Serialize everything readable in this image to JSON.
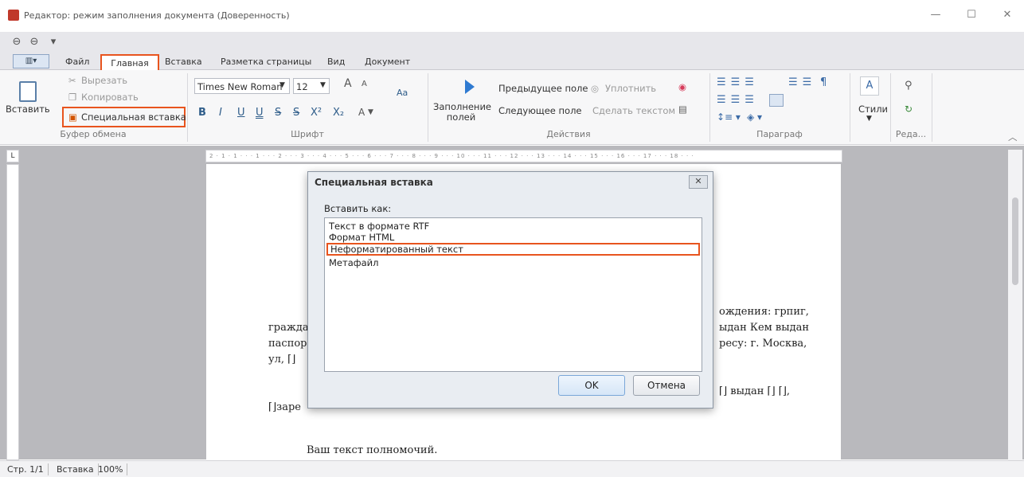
{
  "window": {
    "title": "Редактор: режим заполнения документа (Доверенность)",
    "minimize": "—",
    "maximize": "☐",
    "close": "✕"
  },
  "ribbon_tabs": [
    "Файл",
    "Главная",
    "Вставка",
    "Разметка страницы",
    "Вид",
    "Документ"
  ],
  "view_toggle": "▥▾",
  "clipboard": {
    "paste": "Вставить",
    "cut": "Вырезать",
    "copy": "Копировать",
    "paste_special": "Специальная вставка",
    "group_label": "Буфер обмена"
  },
  "font": {
    "family": "Times New Roman",
    "size": "12",
    "grow": "A",
    "shrink": "A",
    "case": "Aa",
    "bold": "B",
    "italic": "I",
    "underline": "U",
    "double_underline": "U",
    "strike": "S",
    "double_strike": "S",
    "superscript": "X²",
    "subscript": "X₂",
    "color": "A",
    "group_label": "Шрифт"
  },
  "actions": {
    "fill_fields": "Заполнение полей",
    "prev_field": "Предыдущее поле",
    "next_field": "Следующее поле",
    "compact": "Уплотнить",
    "make_text": "Сделать текстом",
    "group_label": "Действия"
  },
  "paragraph": {
    "group_label": "Параграф",
    "pilcrow": "¶"
  },
  "styles": {
    "label": "Стили",
    "edit_label": "Реда..."
  },
  "ruler": {
    "corner": "L",
    "marks": "2 · 1 · 1 · · · 1 · · · 2 · · · 3 · · · 4 · · · 5 · · · 6 · · · 7 · · · 8 · · · 9 · · · 10 · · · 11 · · · 12 · · · 13 · · · 14 · · · 15 · · · 16 · · · 17 · · · 18 · · ·"
  },
  "document": {
    "line1_right": "ождения: грпиг,",
    "line2_left": "граждан",
    "line2_right": "ыдан Кем выдан",
    "line3_left": "паспорт",
    "line3_right": "ресу: г. Москва,",
    "line4_left": "ул, ⌈⌋",
    "line5_right": "⌈⌋ выдан ⌈⌋ ⌈⌋,",
    "line6_left": "⌈⌋заре",
    "line7": "Ваш текст полномочий."
  },
  "dialog": {
    "title": "Специальная вставка",
    "close": "✕",
    "paste_as_label": "Вставить как:",
    "options": [
      "Текст в формате RTF",
      "Формат HTML",
      "Неформатированный текст",
      "Метафайл"
    ],
    "ok": "OK",
    "cancel": "Отмена"
  },
  "statusbar": {
    "page": "Стр. 1/1",
    "mode": "Вставка",
    "zoom": "100%"
  }
}
